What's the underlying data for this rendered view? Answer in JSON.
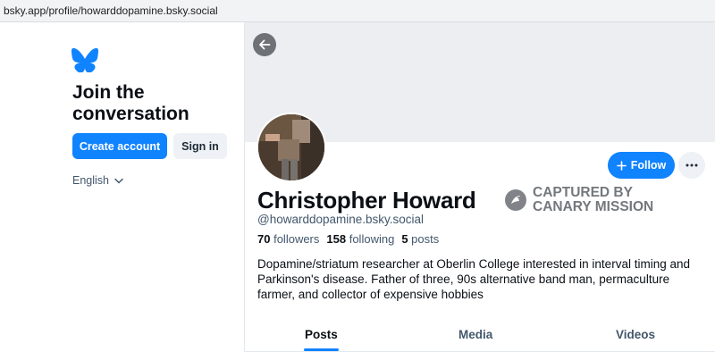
{
  "browser": {
    "url": "bsky.app/profile/howarddopamine.bsky.social"
  },
  "sidebar": {
    "heading": "Join the conversation",
    "create_account_label": "Create account",
    "sign_in_label": "Sign in",
    "language": "English"
  },
  "profile": {
    "display_name": "Christopher Howard",
    "handle": "@howarddopamine.bsky.social",
    "followers_count": "70",
    "followers_label": "followers",
    "following_count": "158",
    "following_label": "following",
    "posts_count": "5",
    "posts_label": "posts",
    "bio": "Dopamine/striatum researcher at Oberlin College interested in interval timing and Parkinson's disease. Father of three, 90s alternative band man, permaculture farmer, and collector of expensive hobbies",
    "follow_label": "Follow"
  },
  "watermark": {
    "line1": "CAPTURED BY",
    "line2": "CANARY MISSION"
  },
  "tabs": [
    {
      "label": "Posts",
      "active": true
    },
    {
      "label": "Media",
      "active": false
    },
    {
      "label": "Videos",
      "active": false
    }
  ],
  "colors": {
    "accent": "#1083fe",
    "banner": "#eceef1",
    "muted_text": "#42576c"
  },
  "icons": {
    "logo": "butterfly-icon",
    "back": "arrow-left-icon",
    "chevron": "chevron-down-icon",
    "plus": "plus-icon",
    "more": "ellipsis-icon",
    "watermark": "canary-icon"
  }
}
